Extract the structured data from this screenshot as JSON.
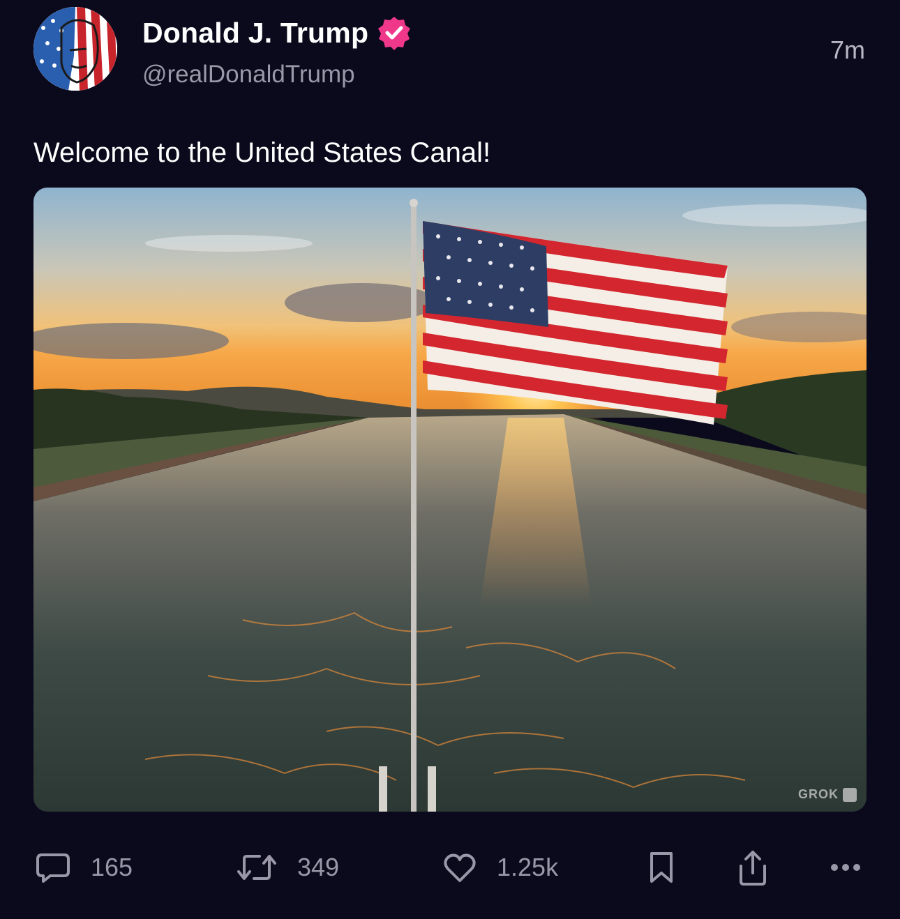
{
  "author": {
    "name": "Donald J. Trump",
    "handle": "@realDonaldTrump",
    "verified_color": "#f0388a"
  },
  "post": {
    "time": "7m",
    "text": "Welcome to the United States Canal!",
    "media": {
      "watermark": "GROK"
    }
  },
  "actions": {
    "replies": "165",
    "reposts": "349",
    "likes": "1.25k"
  },
  "icons": {
    "reply": "speech-bubble-icon",
    "repost": "repost-arrows-icon",
    "like": "heart-icon",
    "bookmark": "bookmark-icon",
    "share": "share-upload-icon",
    "more": "more-dots-icon"
  },
  "colors": {
    "background": "#0b0a1c",
    "secondary_text": "#9a98a8"
  }
}
